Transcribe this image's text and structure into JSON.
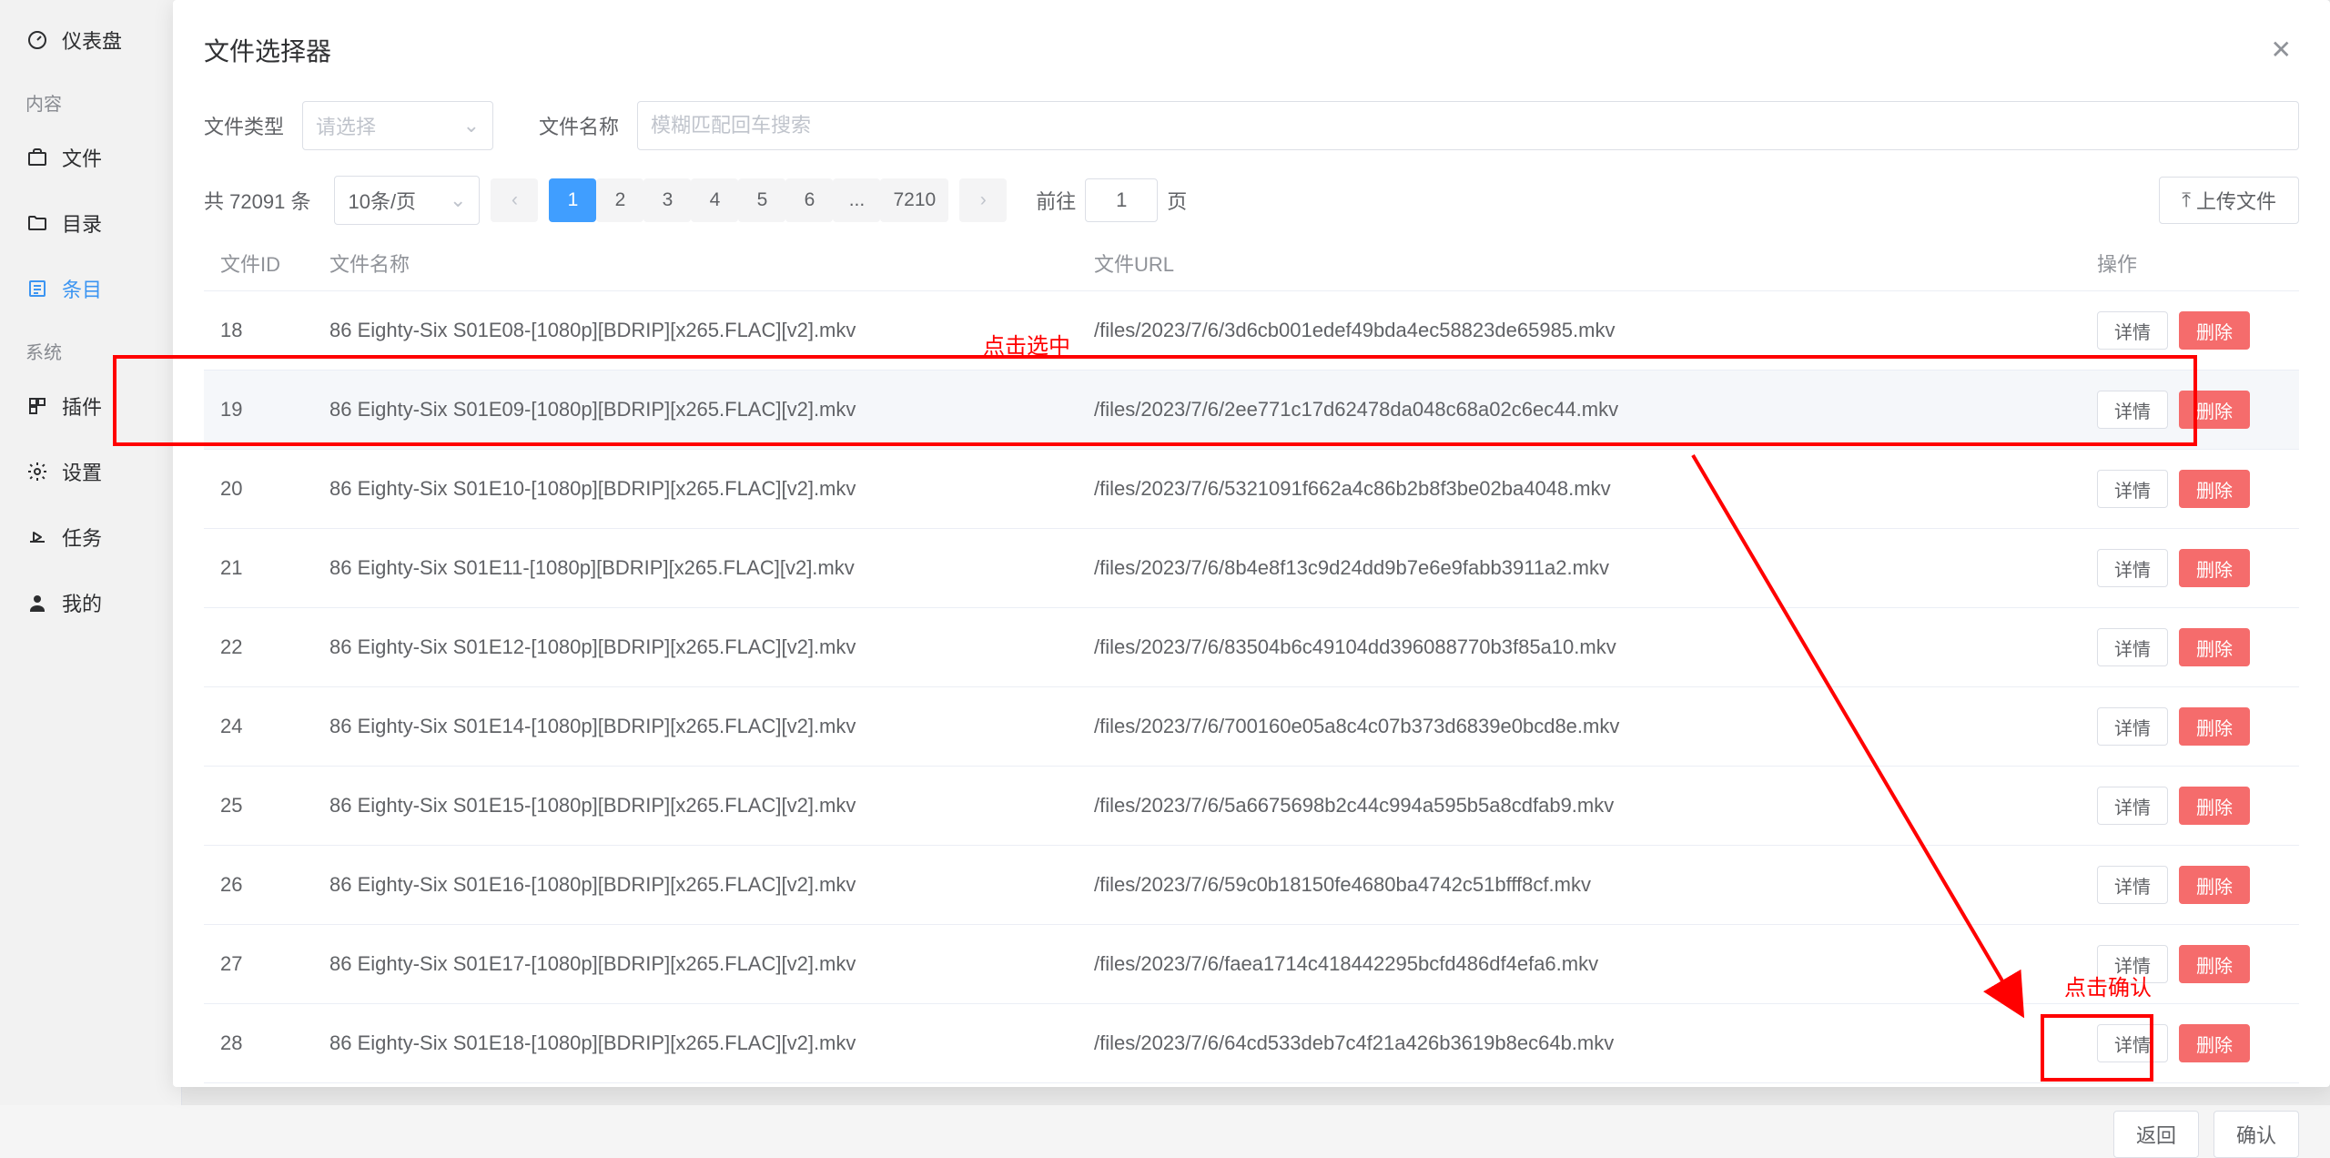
{
  "sidebar": {
    "items": [
      {
        "label": "仪表盘"
      },
      {
        "label": "文件"
      },
      {
        "label": "目录"
      },
      {
        "label": "条目"
      },
      {
        "label": "插件"
      },
      {
        "label": "设置"
      },
      {
        "label": "任务"
      },
      {
        "label": "我的"
      }
    ],
    "groups": {
      "content": "内容",
      "system": "系统"
    }
  },
  "modal": {
    "title": "文件选择器",
    "filters": {
      "type_label": "文件类型",
      "type_placeholder": "请选择",
      "name_label": "文件名称",
      "name_placeholder": "模糊匹配回车搜索"
    },
    "pagination": {
      "total_prefix": "共",
      "total_count": "72091",
      "total_suffix": "条",
      "page_size_label": "10条/页",
      "pages": [
        "1",
        "2",
        "3",
        "4",
        "5",
        "6",
        "...",
        "7210"
      ],
      "active_page": "1",
      "goto_prefix": "前往",
      "goto_value": "1",
      "goto_suffix": "页"
    },
    "upload_label": "上传文件",
    "table": {
      "headers": {
        "id": "文件ID",
        "name": "文件名称",
        "url": "文件URL",
        "ops": "操作"
      },
      "detail_label": "详情",
      "delete_label": "删除",
      "rows": [
        {
          "id": "18",
          "name": "86 Eighty-Six S01E08-[1080p][BDRIP][x265.FLAC][v2].mkv",
          "url": "/files/2023/7/6/3d6cb001edef49bda4ec58823de65985.mkv"
        },
        {
          "id": "19",
          "name": "86 Eighty-Six S01E09-[1080p][BDRIP][x265.FLAC][v2].mkv",
          "url": "/files/2023/7/6/2ee771c17d62478da048c68a02c6ec44.mkv"
        },
        {
          "id": "20",
          "name": "86 Eighty-Six S01E10-[1080p][BDRIP][x265.FLAC][v2].mkv",
          "url": "/files/2023/7/6/5321091f662a4c86b2b8f3be02ba4048.mkv"
        },
        {
          "id": "21",
          "name": "86 Eighty-Six S01E11-[1080p][BDRIP][x265.FLAC][v2].mkv",
          "url": "/files/2023/7/6/8b4e8f13c9d24dd9b7e6e9fabb3911a2.mkv"
        },
        {
          "id": "22",
          "name": "86 Eighty-Six S01E12-[1080p][BDRIP][x265.FLAC][v2].mkv",
          "url": "/files/2023/7/6/83504b6c49104dd396088770b3f85a10.mkv"
        },
        {
          "id": "24",
          "name": "86 Eighty-Six S01E14-[1080p][BDRIP][x265.FLAC][v2].mkv",
          "url": "/files/2023/7/6/700160e05a8c4c07b373d6839e0bcd8e.mkv"
        },
        {
          "id": "25",
          "name": "86 Eighty-Six S01E15-[1080p][BDRIP][x265.FLAC][v2].mkv",
          "url": "/files/2023/7/6/5a6675698b2c44c994a595b5a8cdfab9.mkv"
        },
        {
          "id": "26",
          "name": "86 Eighty-Six S01E16-[1080p][BDRIP][x265.FLAC][v2].mkv",
          "url": "/files/2023/7/6/59c0b18150fe4680ba4742c51bfff8cf.mkv"
        },
        {
          "id": "27",
          "name": "86 Eighty-Six S01E17-[1080p][BDRIP][x265.FLAC][v2].mkv",
          "url": "/files/2023/7/6/faea1714c418442295bcfd486df4efa6.mkv"
        },
        {
          "id": "28",
          "name": "86 Eighty-Six S01E18-[1080p][BDRIP][x265.FLAC][v2].mkv",
          "url": "/files/2023/7/6/64cd533deb7c4f21a426b3619b8ec64b.mkv"
        }
      ]
    },
    "footer": {
      "back": "返回",
      "confirm": "确认"
    }
  },
  "annotations": {
    "select_label": "点击选中",
    "confirm_label": "点击确认"
  }
}
